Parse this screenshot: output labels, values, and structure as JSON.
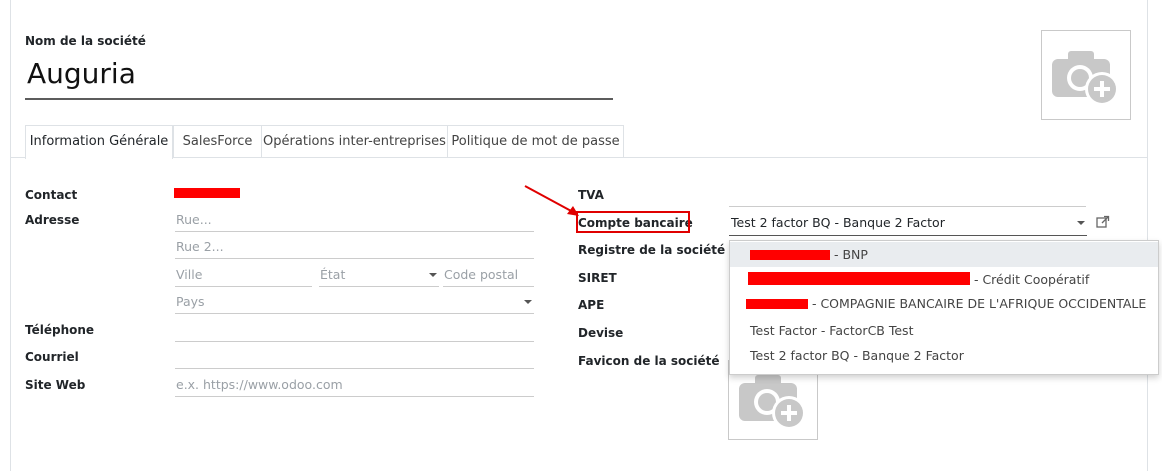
{
  "form": {
    "name_label": "Nom de la société",
    "name_value": "Auguria"
  },
  "tabs": [
    {
      "label": "Information Générale",
      "active": true
    },
    {
      "label": "SalesForce",
      "active": false
    },
    {
      "label": "Opérations inter-entreprises",
      "active": false
    },
    {
      "label": "Politique de mot de passe",
      "active": false
    }
  ],
  "left": {
    "contact_label": "Contact",
    "address_label": "Adresse",
    "street_placeholder": "Rue...",
    "street2_placeholder": "Rue 2...",
    "city_placeholder": "Ville",
    "state_placeholder": "État",
    "zip_placeholder": "Code postal",
    "country_placeholder": "Pays",
    "phone_label": "Téléphone",
    "email_label": "Courriel",
    "website_label": "Site Web",
    "website_placeholder": "e.x. https://www.odoo.com"
  },
  "right": {
    "vat_label": "TVA",
    "bank_label": "Compte bancaire",
    "bank_value": "Test 2 factor BQ - Banque 2 Factor",
    "registry_label": "Registre de la société",
    "siret_label": "SIRET",
    "ape_label": "APE",
    "currency_label": "Devise",
    "favicon_label": "Favicon de la société"
  },
  "dropdown": {
    "items": [
      {
        "text": " - BNP",
        "redacted": true,
        "highlighted": true
      },
      {
        "text": " - Crédit Coopératif",
        "redacted": true,
        "highlighted": false
      },
      {
        "text": " - COMPAGNIE BANCAIRE DE L'AFRIQUE OCCIDENTALE",
        "redacted": true,
        "highlighted": false
      },
      {
        "text": "Test Factor - FactorCB Test",
        "redacted": false,
        "highlighted": false
      },
      {
        "text": "Test 2 factor BQ - Banque 2 Factor",
        "redacted": false,
        "highlighted": false
      }
    ]
  },
  "colors": {
    "redaction": "#ff0000",
    "annotation": "#e00000",
    "dropdown_highlight": "#e9ecef"
  },
  "icons": [
    "camera-plus-icon",
    "external-link-icon",
    "caret-down-icon",
    "annotation-arrow-icon"
  ]
}
